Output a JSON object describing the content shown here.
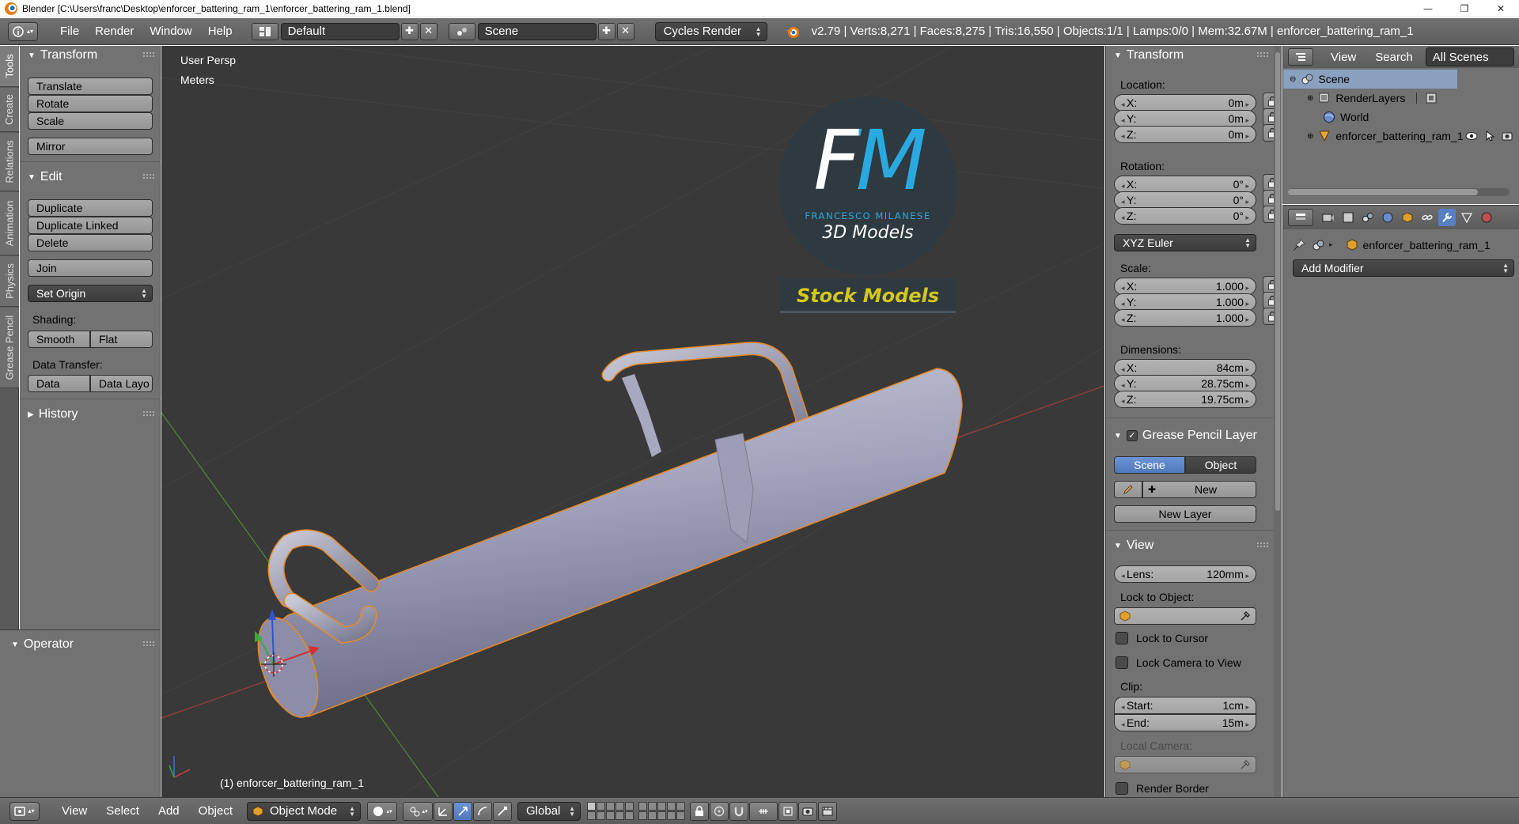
{
  "window": {
    "title": "Blender [C:\\Users\\franc\\Desktop\\enforcer_battering_ram_1\\enforcer_battering_ram_1.blend]",
    "controls": [
      "—",
      "❐",
      "✕"
    ]
  },
  "header": {
    "menus": [
      "File",
      "Render",
      "Window",
      "Help"
    ],
    "layout": "Default",
    "scene": "Scene",
    "engine": "Cycles Render",
    "stats": "v2.79 | Verts:8,271 | Faces:8,275 | Tris:16,550 | Objects:1/1 | Lamps:0/0 | Mem:32.67M | enforcer_battering_ram_1"
  },
  "tool_tabs": [
    "Tools",
    "Create",
    "Relations",
    "Animation",
    "Physics",
    "Grease Pencil"
  ],
  "toolshelf": {
    "transform_title": "Transform",
    "transform_buttons": [
      "Translate",
      "Rotate",
      "Scale"
    ],
    "mirror": "Mirror",
    "edit_title": "Edit",
    "edit_buttons": [
      "Duplicate",
      "Duplicate Linked",
      "Delete"
    ],
    "join": "Join",
    "set_origin": "Set Origin",
    "shading_label": "Shading:",
    "smooth": "Smooth",
    "flat": "Flat",
    "data_transfer_label": "Data Transfer:",
    "data": "Data",
    "data_layout": "Data Layo",
    "history_title": "History"
  },
  "operator": {
    "title": "Operator"
  },
  "viewport": {
    "view_name": "User Persp",
    "units": "Meters",
    "object_label": "(1) enforcer_battering_ram_1",
    "watermark": {
      "initials": "FM",
      "author": "FRANCESCO MILANESE",
      "tagline": "3D Models",
      "banner": "Stock Models"
    },
    "colors": {
      "background": "#393939",
      "object": "#9c9cb9",
      "outline": "#e88a22",
      "x_axis": "#c2484a",
      "y_axis": "#4f8a3a"
    }
  },
  "npanel": {
    "transform_title": "Transform",
    "location_label": "Location:",
    "location": [
      [
        "X:",
        "0m"
      ],
      [
        "Y:",
        "0m"
      ],
      [
        "Z:",
        "0m"
      ]
    ],
    "rotation_label": "Rotation:",
    "rotation": [
      [
        "X:",
        "0°"
      ],
      [
        "Y:",
        "0°"
      ],
      [
        "Z:",
        "0°"
      ]
    ],
    "rotation_mode": "XYZ Euler",
    "scale_label": "Scale:",
    "scale": [
      [
        "X:",
        "1.000"
      ],
      [
        "Y:",
        "1.000"
      ],
      [
        "Z:",
        "1.000"
      ]
    ],
    "dimensions_label": "Dimensions:",
    "dimensions": [
      [
        "X:",
        "84cm"
      ],
      [
        "Y:",
        "28.75cm"
      ],
      [
        "Z:",
        "19.75cm"
      ]
    ],
    "grease_title": "Grease Pencil Layer",
    "gp_scene": "Scene",
    "gp_object": "Object",
    "gp_new": "New",
    "gp_new_layer": "New Layer",
    "view_title": "View",
    "lens_label": "Lens:",
    "lens_value": "120mm",
    "lock_object_label": "Lock to Object:",
    "lock_cursor": "Lock to Cursor",
    "lock_camera": "Lock Camera to View",
    "clip_label": "Clip:",
    "clip_start_label": "Start:",
    "clip_start": "1cm",
    "clip_end_label": "End:",
    "clip_end": "15m",
    "local_camera_label": "Local Camera:",
    "render_border": "Render Border"
  },
  "outliner": {
    "menus": [
      "View",
      "Search"
    ],
    "filter": "All Scenes",
    "items": [
      "Scene",
      "RenderLayers",
      "World",
      "enforcer_battering_ram_1"
    ]
  },
  "properties": {
    "object_name": "enforcer_battering_ram_1",
    "add_modifier": "Add Modifier"
  },
  "bottom": {
    "menus": [
      "View",
      "Select",
      "Add",
      "Object"
    ],
    "mode": "Object Mode",
    "orientation": "Global"
  }
}
